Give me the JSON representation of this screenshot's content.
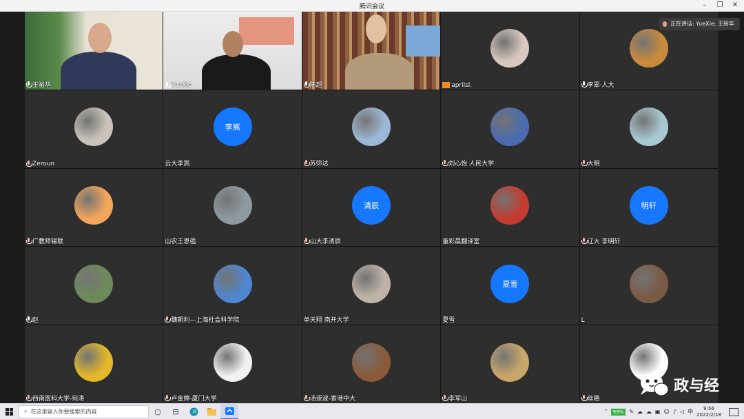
{
  "window": {
    "title": "腾讯会议"
  },
  "speaking": {
    "text": "正在讲话: YueXie; 王裕华"
  },
  "tiles": [
    {
      "name": "王裕华",
      "mic": "on",
      "kind": "video",
      "scene": "a"
    },
    {
      "name": "YueXie",
      "mic": "on",
      "kind": "video",
      "scene": "b",
      "active": true
    },
    {
      "name": "陈超",
      "mic": "on",
      "kind": "video",
      "scene": "c"
    },
    {
      "name": "aprilsl.",
      "mic": "badge",
      "kind": "photo",
      "bg": "#d8c8c0"
    },
    {
      "name": "李翠·人大",
      "mic": "on",
      "kind": "photo",
      "bg": "#c98a3d"
    },
    {
      "name": "Zeroun",
      "mic": "off",
      "kind": "photo",
      "bg": "#c9c3bb"
    },
    {
      "name": "云大李嵩",
      "mic": "none",
      "kind": "text",
      "avatar_text": "李嵩"
    },
    {
      "name": "苏弥达",
      "mic": "off",
      "kind": "photo",
      "bg": "#9db8d6"
    },
    {
      "name": "刘心怡  人民大学",
      "mic": "off",
      "kind": "photo",
      "bg": "#4a6bb0"
    },
    {
      "name": "大明",
      "mic": "off",
      "kind": "photo",
      "bg": "#a8c9d1"
    },
    {
      "name": "广教师锡联",
      "mic": "off",
      "kind": "photo",
      "bg": "#f4a55a"
    },
    {
      "name": "山农王恩强",
      "mic": "none",
      "kind": "photo",
      "bg": "#8d9aa0"
    },
    {
      "name": "山大李清辰",
      "mic": "off",
      "kind": "text",
      "avatar_text": "清辰"
    },
    {
      "name": "董彩晨翻译室",
      "mic": "none",
      "kind": "photo",
      "bg": "#c53c2e"
    },
    {
      "name": "辽大 李明轩",
      "mic": "off",
      "kind": "text",
      "avatar_text": "明轩"
    },
    {
      "name": "赵",
      "mic": "on",
      "kind": "photo",
      "bg": "#6f8a5a"
    },
    {
      "name": "魏朝利—上海社会科学院",
      "mic": "off",
      "kind": "photo",
      "bg": "#4f86cf"
    },
    {
      "name": "单天翔 南开大学",
      "mic": "none",
      "kind": "photo",
      "bg": "#bfb3a8"
    },
    {
      "name": "夏雪",
      "mic": "none",
      "kind": "text",
      "avatar_text": "夏雪"
    },
    {
      "name": "L",
      "mic": "none",
      "kind": "photo",
      "bg": "#7a5a45"
    },
    {
      "name": "西南医科大学-何涛",
      "mic": "off",
      "kind": "photo",
      "bg": "#e3b82a"
    },
    {
      "name": "卢金婷-厦门大学",
      "mic": "off",
      "kind": "photo",
      "bg": "#f2f2f2"
    },
    {
      "name": "汤崇波-香港中大",
      "mic": "off",
      "kind": "photo",
      "bg": "#8a5a3a"
    },
    {
      "name": "李军山",
      "mic": "off",
      "kind": "photo",
      "bg": "#c9a76a"
    },
    {
      "name": "丝路",
      "mic": "off",
      "kind": "photo",
      "bg": "#ffffff"
    }
  ],
  "watermark": {
    "text": "政与经"
  },
  "taskbar": {
    "search_placeholder": "在这里输入你要搜索的内容",
    "battery": "99%",
    "ime": "中",
    "time": "9:56",
    "date": "2022/2/18"
  }
}
